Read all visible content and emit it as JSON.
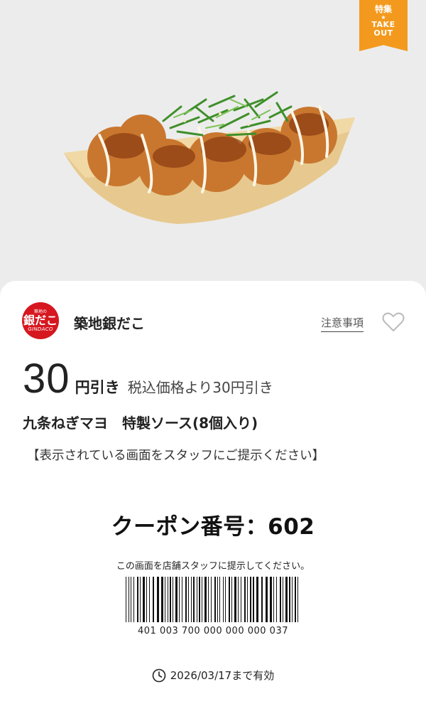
{
  "badge": {
    "line1": "特集",
    "star": "★",
    "line2": "TAKE",
    "line3": "OUT"
  },
  "store": {
    "logo_top": "築地の",
    "logo_main": "銀だこ",
    "logo_sub": "GINDACO",
    "name": "築地銀だこ",
    "notes_link": "注意事項"
  },
  "coupon": {
    "amount": "30",
    "unit": "円引き",
    "description": "税込価格より30円引き",
    "product": "九条ねぎマヨ　特製ソース(8個入り)",
    "instruction": "【表示されている画面をスタッフにご提示ください】",
    "number_label": "クーポン番号：602",
    "barcode_caption": "この画面を店舗スタッフに提示してください。",
    "barcode_digits": "401 003 700 000 000 000 037",
    "validity": "2026/03/17まで有効"
  },
  "colors": {
    "brand_red": "#d6171f",
    "badge_orange": "#f39a1e"
  },
  "icons": {
    "favorite": "heart-icon",
    "validity": "clock-icon"
  }
}
